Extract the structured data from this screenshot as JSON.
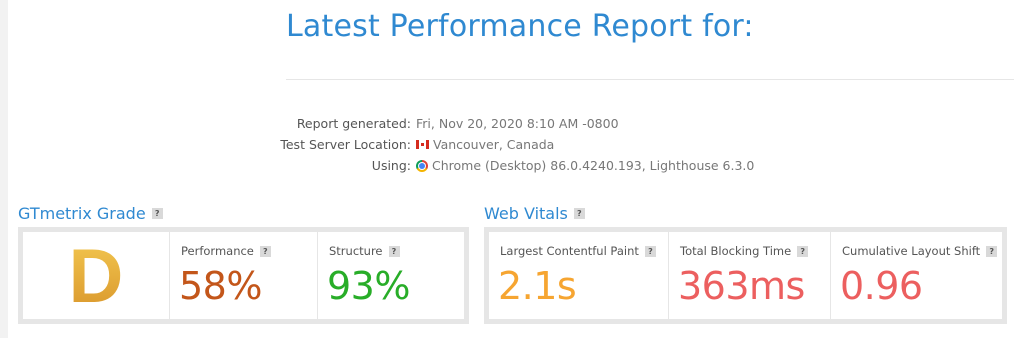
{
  "header": {
    "title": "Latest Performance Report for:"
  },
  "report_meta": {
    "generated_label": "Report generated:",
    "generated_value": "Fri, Nov 20, 2020 8:10 AM -0800",
    "location_label": "Test Server Location:",
    "location_value": "Vancouver, Canada",
    "using_label": "Using:",
    "using_value": "Chrome (Desktop) 86.0.4240.193, Lighthouse 6.3.0",
    "location_flag": "canada-flag-icon",
    "browser_icon": "chrome-icon"
  },
  "gtmetrix_grade": {
    "title": "GTmetrix Grade",
    "help": "?",
    "grade": "D",
    "grade_color": "#e0a232",
    "performance_label": "Performance",
    "performance_value": "58%",
    "performance_color": "#c3561a",
    "structure_label": "Structure",
    "structure_value": "93%",
    "structure_color": "#28ad28"
  },
  "web_vitals": {
    "title": "Web Vitals",
    "help": "?",
    "lcp_label": "Largest Contentful Paint",
    "lcp_value": "2.1s",
    "lcp_color": "#f6a531",
    "tbt_label": "Total Blocking Time",
    "tbt_value": "363ms",
    "tbt_color": "#ec5f5f",
    "cls_label": "Cumulative Layout Shift",
    "cls_value": "0.96",
    "cls_color": "#ec5f5f"
  }
}
